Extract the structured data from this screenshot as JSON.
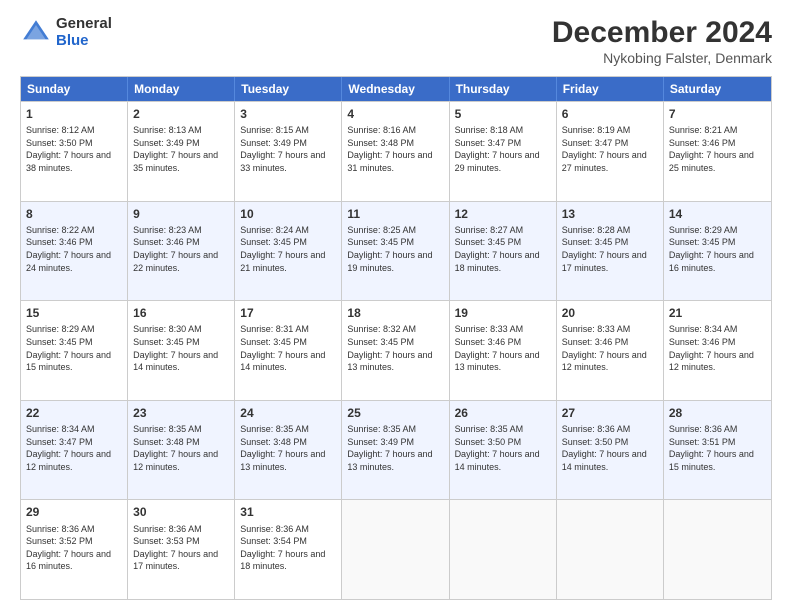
{
  "header": {
    "logo_general": "General",
    "logo_blue": "Blue",
    "month_title": "December 2024",
    "location": "Nykobing Falster, Denmark"
  },
  "days_of_week": [
    "Sunday",
    "Monday",
    "Tuesday",
    "Wednesday",
    "Thursday",
    "Friday",
    "Saturday"
  ],
  "weeks": [
    [
      {
        "day": "1",
        "sunrise": "Sunrise: 8:12 AM",
        "sunset": "Sunset: 3:50 PM",
        "daylight": "Daylight: 7 hours and 38 minutes.",
        "shaded": false
      },
      {
        "day": "2",
        "sunrise": "Sunrise: 8:13 AM",
        "sunset": "Sunset: 3:49 PM",
        "daylight": "Daylight: 7 hours and 35 minutes.",
        "shaded": false
      },
      {
        "day": "3",
        "sunrise": "Sunrise: 8:15 AM",
        "sunset": "Sunset: 3:49 PM",
        "daylight": "Daylight: 7 hours and 33 minutes.",
        "shaded": false
      },
      {
        "day": "4",
        "sunrise": "Sunrise: 8:16 AM",
        "sunset": "Sunset: 3:48 PM",
        "daylight": "Daylight: 7 hours and 31 minutes.",
        "shaded": false
      },
      {
        "day": "5",
        "sunrise": "Sunrise: 8:18 AM",
        "sunset": "Sunset: 3:47 PM",
        "daylight": "Daylight: 7 hours and 29 minutes.",
        "shaded": false
      },
      {
        "day": "6",
        "sunrise": "Sunrise: 8:19 AM",
        "sunset": "Sunset: 3:47 PM",
        "daylight": "Daylight: 7 hours and 27 minutes.",
        "shaded": false
      },
      {
        "day": "7",
        "sunrise": "Sunrise: 8:21 AM",
        "sunset": "Sunset: 3:46 PM",
        "daylight": "Daylight: 7 hours and 25 minutes.",
        "shaded": false
      }
    ],
    [
      {
        "day": "8",
        "sunrise": "Sunrise: 8:22 AM",
        "sunset": "Sunset: 3:46 PM",
        "daylight": "Daylight: 7 hours and 24 minutes.",
        "shaded": true
      },
      {
        "day": "9",
        "sunrise": "Sunrise: 8:23 AM",
        "sunset": "Sunset: 3:46 PM",
        "daylight": "Daylight: 7 hours and 22 minutes.",
        "shaded": true
      },
      {
        "day": "10",
        "sunrise": "Sunrise: 8:24 AM",
        "sunset": "Sunset: 3:45 PM",
        "daylight": "Daylight: 7 hours and 21 minutes.",
        "shaded": true
      },
      {
        "day": "11",
        "sunrise": "Sunrise: 8:25 AM",
        "sunset": "Sunset: 3:45 PM",
        "daylight": "Daylight: 7 hours and 19 minutes.",
        "shaded": true
      },
      {
        "day": "12",
        "sunrise": "Sunrise: 8:27 AM",
        "sunset": "Sunset: 3:45 PM",
        "daylight": "Daylight: 7 hours and 18 minutes.",
        "shaded": true
      },
      {
        "day": "13",
        "sunrise": "Sunrise: 8:28 AM",
        "sunset": "Sunset: 3:45 PM",
        "daylight": "Daylight: 7 hours and 17 minutes.",
        "shaded": true
      },
      {
        "day": "14",
        "sunrise": "Sunrise: 8:29 AM",
        "sunset": "Sunset: 3:45 PM",
        "daylight": "Daylight: 7 hours and 16 minutes.",
        "shaded": true
      }
    ],
    [
      {
        "day": "15",
        "sunrise": "Sunrise: 8:29 AM",
        "sunset": "Sunset: 3:45 PM",
        "daylight": "Daylight: 7 hours and 15 minutes.",
        "shaded": false
      },
      {
        "day": "16",
        "sunrise": "Sunrise: 8:30 AM",
        "sunset": "Sunset: 3:45 PM",
        "daylight": "Daylight: 7 hours and 14 minutes.",
        "shaded": false
      },
      {
        "day": "17",
        "sunrise": "Sunrise: 8:31 AM",
        "sunset": "Sunset: 3:45 PM",
        "daylight": "Daylight: 7 hours and 14 minutes.",
        "shaded": false
      },
      {
        "day": "18",
        "sunrise": "Sunrise: 8:32 AM",
        "sunset": "Sunset: 3:45 PM",
        "daylight": "Daylight: 7 hours and 13 minutes.",
        "shaded": false
      },
      {
        "day": "19",
        "sunrise": "Sunrise: 8:33 AM",
        "sunset": "Sunset: 3:46 PM",
        "daylight": "Daylight: 7 hours and 13 minutes.",
        "shaded": false
      },
      {
        "day": "20",
        "sunrise": "Sunrise: 8:33 AM",
        "sunset": "Sunset: 3:46 PM",
        "daylight": "Daylight: 7 hours and 12 minutes.",
        "shaded": false
      },
      {
        "day": "21",
        "sunrise": "Sunrise: 8:34 AM",
        "sunset": "Sunset: 3:46 PM",
        "daylight": "Daylight: 7 hours and 12 minutes.",
        "shaded": false
      }
    ],
    [
      {
        "day": "22",
        "sunrise": "Sunrise: 8:34 AM",
        "sunset": "Sunset: 3:47 PM",
        "daylight": "Daylight: 7 hours and 12 minutes.",
        "shaded": true
      },
      {
        "day": "23",
        "sunrise": "Sunrise: 8:35 AM",
        "sunset": "Sunset: 3:48 PM",
        "daylight": "Daylight: 7 hours and 12 minutes.",
        "shaded": true
      },
      {
        "day": "24",
        "sunrise": "Sunrise: 8:35 AM",
        "sunset": "Sunset: 3:48 PM",
        "daylight": "Daylight: 7 hours and 13 minutes.",
        "shaded": true
      },
      {
        "day": "25",
        "sunrise": "Sunrise: 8:35 AM",
        "sunset": "Sunset: 3:49 PM",
        "daylight": "Daylight: 7 hours and 13 minutes.",
        "shaded": true
      },
      {
        "day": "26",
        "sunrise": "Sunrise: 8:35 AM",
        "sunset": "Sunset: 3:50 PM",
        "daylight": "Daylight: 7 hours and 14 minutes.",
        "shaded": true
      },
      {
        "day": "27",
        "sunrise": "Sunrise: 8:36 AM",
        "sunset": "Sunset: 3:50 PM",
        "daylight": "Daylight: 7 hours and 14 minutes.",
        "shaded": true
      },
      {
        "day": "28",
        "sunrise": "Sunrise: 8:36 AM",
        "sunset": "Sunset: 3:51 PM",
        "daylight": "Daylight: 7 hours and 15 minutes.",
        "shaded": true
      }
    ],
    [
      {
        "day": "29",
        "sunrise": "Sunrise: 8:36 AM",
        "sunset": "Sunset: 3:52 PM",
        "daylight": "Daylight: 7 hours and 16 minutes.",
        "shaded": false
      },
      {
        "day": "30",
        "sunrise": "Sunrise: 8:36 AM",
        "sunset": "Sunset: 3:53 PM",
        "daylight": "Daylight: 7 hours and 17 minutes.",
        "shaded": false
      },
      {
        "day": "31",
        "sunrise": "Sunrise: 8:36 AM",
        "sunset": "Sunset: 3:54 PM",
        "daylight": "Daylight: 7 hours and 18 minutes.",
        "shaded": false
      },
      {
        "day": "",
        "sunrise": "",
        "sunset": "",
        "daylight": "",
        "shaded": false,
        "empty": true
      },
      {
        "day": "",
        "sunrise": "",
        "sunset": "",
        "daylight": "",
        "shaded": false,
        "empty": true
      },
      {
        "day": "",
        "sunrise": "",
        "sunset": "",
        "daylight": "",
        "shaded": false,
        "empty": true
      },
      {
        "day": "",
        "sunrise": "",
        "sunset": "",
        "daylight": "",
        "shaded": false,
        "empty": true
      }
    ]
  ]
}
